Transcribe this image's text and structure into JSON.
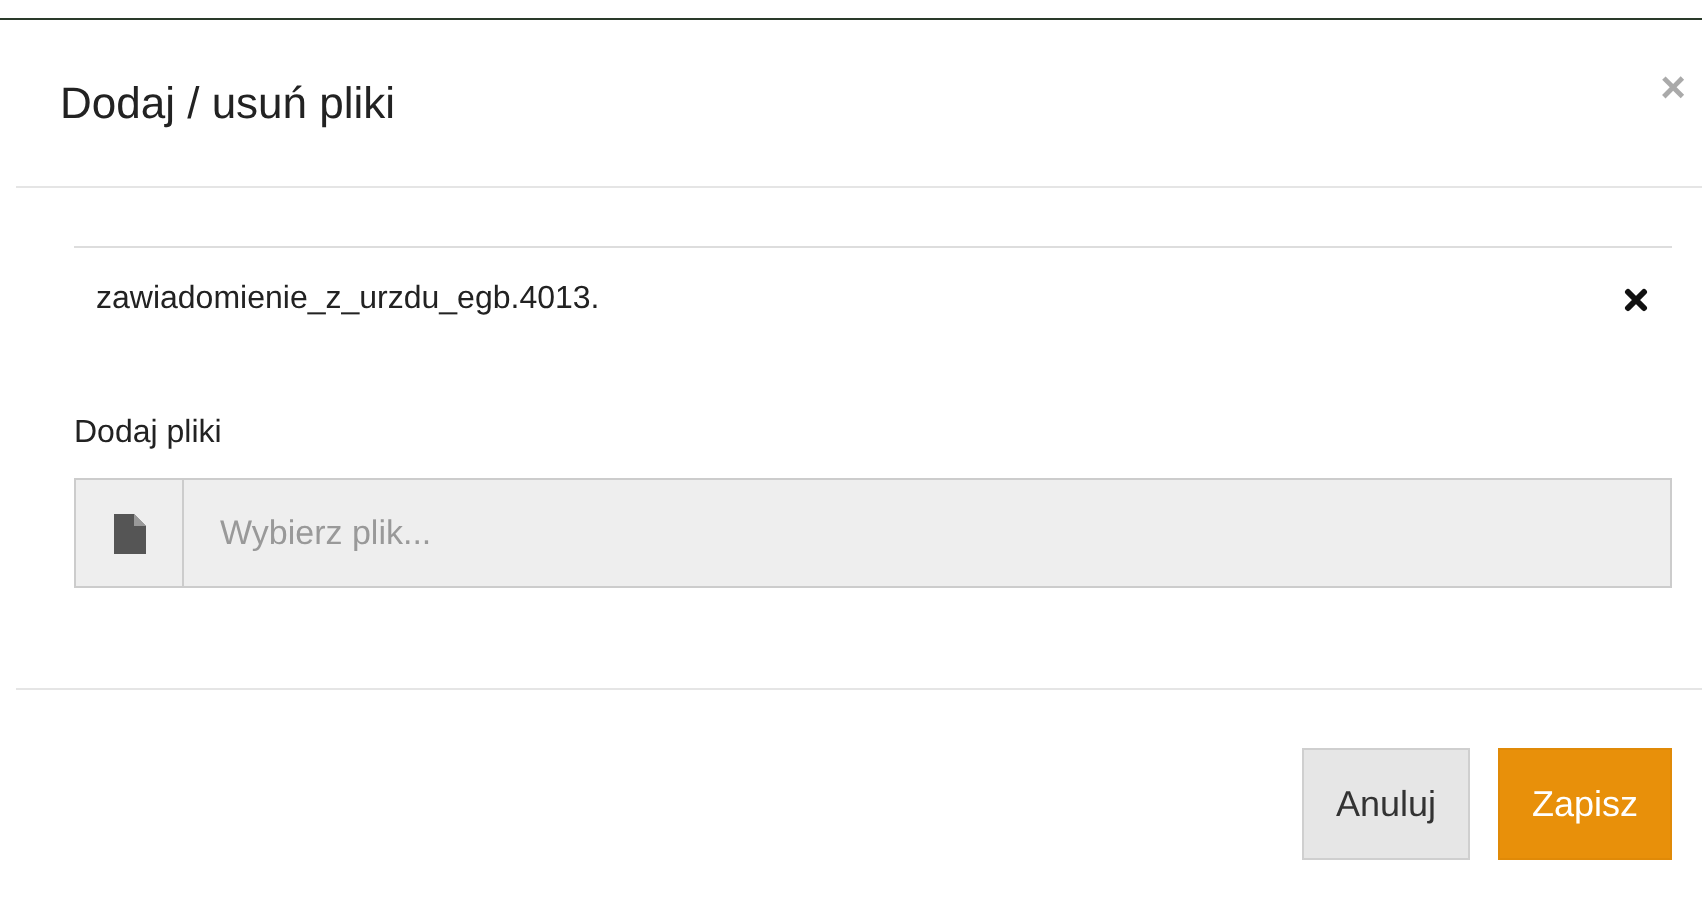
{
  "dialog": {
    "title": "Dodaj / usuń pliki",
    "close": "×"
  },
  "files": [
    {
      "name": "zawiadomienie_z_urzdu_egb.4013."
    }
  ],
  "upload": {
    "label": "Dodaj pliki",
    "placeholder": "Wybierz plik..."
  },
  "buttons": [
    {
      "label": "Anuluj",
      "kind": "secondary"
    },
    {
      "label": "Zapisz",
      "kind": "primary"
    }
  ]
}
